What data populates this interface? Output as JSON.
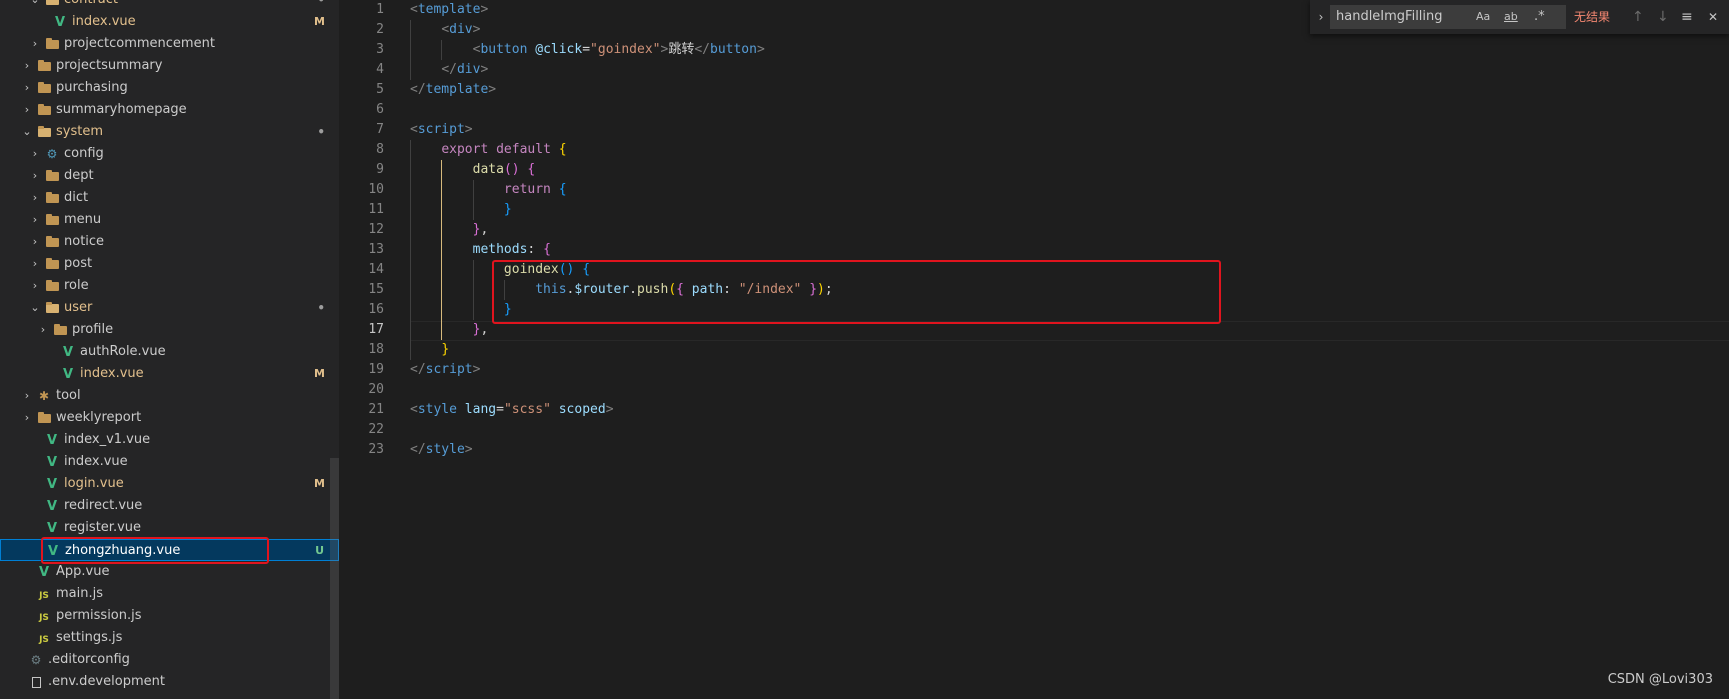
{
  "explorer": {
    "rows": [
      {
        "label": "contract",
        "type": "folder-open",
        "indent": 2,
        "expanded": true,
        "badge": "•",
        "badge_type": "dot",
        "status": "modified"
      },
      {
        "label": "index.vue",
        "type": "vue",
        "indent": 3,
        "badge": "M",
        "badge_type": "M",
        "status": "modified"
      },
      {
        "label": "projectcommencement",
        "type": "folder",
        "indent": 2,
        "expanded": false
      },
      {
        "label": "projectsummary",
        "type": "folder",
        "indent": 1,
        "expanded": false
      },
      {
        "label": "purchasing",
        "type": "folder",
        "indent": 1,
        "expanded": false
      },
      {
        "label": "summaryhomepage",
        "type": "folder",
        "indent": 1,
        "expanded": false
      },
      {
        "label": "system",
        "type": "folder-open",
        "indent": 1,
        "expanded": true,
        "badge": "•",
        "badge_type": "dot",
        "status": "modified"
      },
      {
        "label": "config",
        "type": "config",
        "indent": 2,
        "expanded": false
      },
      {
        "label": "dept",
        "type": "folder",
        "indent": 2,
        "expanded": false
      },
      {
        "label": "dict",
        "type": "folder",
        "indent": 2,
        "expanded": false
      },
      {
        "label": "menu",
        "type": "folder",
        "indent": 2,
        "expanded": false
      },
      {
        "label": "notice",
        "type": "folder",
        "indent": 2,
        "expanded": false
      },
      {
        "label": "post",
        "type": "folder",
        "indent": 2,
        "expanded": false
      },
      {
        "label": "role",
        "type": "folder",
        "indent": 2,
        "expanded": false
      },
      {
        "label": "user",
        "type": "folder-open",
        "indent": 2,
        "expanded": true,
        "badge": "•",
        "badge_type": "dot",
        "status": "modified"
      },
      {
        "label": "profile",
        "type": "folder",
        "indent": 3,
        "expanded": false
      },
      {
        "label": "authRole.vue",
        "type": "vue",
        "indent": 4
      },
      {
        "label": "index.vue",
        "type": "vue",
        "indent": 4,
        "badge": "M",
        "badge_type": "M",
        "status": "modified"
      },
      {
        "label": "tool",
        "type": "tool",
        "indent": 1,
        "expanded": false
      },
      {
        "label": "weeklyreport",
        "type": "folder",
        "indent": 1,
        "expanded": false
      },
      {
        "label": "index_v1.vue",
        "type": "vue",
        "indent": 2
      },
      {
        "label": "index.vue",
        "type": "vue",
        "indent": 2
      },
      {
        "label": "login.vue",
        "type": "vue",
        "indent": 2,
        "badge": "M",
        "badge_type": "M",
        "status": "modified"
      },
      {
        "label": "redirect.vue",
        "type": "vue",
        "indent": 2
      },
      {
        "label": "register.vue",
        "type": "vue",
        "indent": 2
      },
      {
        "label": "zhongzhuang.vue",
        "type": "vue",
        "indent": 2,
        "badge": "U",
        "badge_type": "U",
        "status": "untracked",
        "selected": true
      },
      {
        "label": "App.vue",
        "type": "vue",
        "indent": 1
      },
      {
        "label": "main.js",
        "type": "js",
        "indent": 1
      },
      {
        "label": "permission.js",
        "type": "js",
        "indent": 1
      },
      {
        "label": "settings.js",
        "type": "js",
        "indent": 1
      },
      {
        "label": ".editorconfig",
        "type": "gear",
        "indent": 0
      },
      {
        "label": ".env.development",
        "type": "file",
        "indent": 0
      }
    ]
  },
  "editor": {
    "active_line": 17,
    "lines": [
      [
        [
          "t-tag",
          "<"
        ],
        [
          "t-name",
          "template"
        ],
        [
          "t-tag",
          ">"
        ]
      ],
      [
        [
          "t-txt",
          "    "
        ],
        [
          "t-tag",
          "<"
        ],
        [
          "t-name",
          "div"
        ],
        [
          "t-tag",
          ">"
        ]
      ],
      [
        [
          "t-txt",
          "        "
        ],
        [
          "t-tag",
          "<"
        ],
        [
          "t-name",
          "button"
        ],
        [
          "t-txt",
          " "
        ],
        [
          "t-attr",
          "@click"
        ],
        [
          "t-txt",
          "="
        ],
        [
          "t-str",
          "\"goindex\""
        ],
        [
          "t-tag",
          ">"
        ],
        [
          "t-txt",
          "跳转"
        ],
        [
          "t-tag",
          "</"
        ],
        [
          "t-name",
          "button"
        ],
        [
          "t-tag",
          ">"
        ]
      ],
      [
        [
          "t-txt",
          "    "
        ],
        [
          "t-tag",
          "</"
        ],
        [
          "t-name",
          "div"
        ],
        [
          "t-tag",
          ">"
        ]
      ],
      [
        [
          "t-tag",
          "</"
        ],
        [
          "t-name",
          "template"
        ],
        [
          "t-tag",
          ">"
        ]
      ],
      [],
      [
        [
          "t-tag",
          "<"
        ],
        [
          "t-name",
          "script"
        ],
        [
          "t-tag",
          ">"
        ]
      ],
      [
        [
          "t-txt",
          "    "
        ],
        [
          "t-kw",
          "export"
        ],
        [
          "t-txt",
          " "
        ],
        [
          "t-kw",
          "default"
        ],
        [
          "t-txt",
          " "
        ],
        [
          "b1",
          "{"
        ]
      ],
      [
        [
          "t-txt",
          "        "
        ],
        [
          "t-fn",
          "data"
        ],
        [
          "b2",
          "()"
        ],
        [
          "t-txt",
          " "
        ],
        [
          "b2",
          "{"
        ]
      ],
      [
        [
          "t-txt",
          "            "
        ],
        [
          "t-kw",
          "return"
        ],
        [
          "t-txt",
          " "
        ],
        [
          "b3",
          "{"
        ]
      ],
      [
        [
          "t-txt",
          "            "
        ],
        [
          "b3",
          "}"
        ]
      ],
      [
        [
          "t-txt",
          "        "
        ],
        [
          "b2",
          "}"
        ],
        [
          "t-txt",
          ","
        ]
      ],
      [
        [
          "t-txt",
          "        "
        ],
        [
          "t-var",
          "methods"
        ],
        [
          "t-txt",
          ": "
        ],
        [
          "b2",
          "{"
        ]
      ],
      [
        [
          "t-txt",
          "            "
        ],
        [
          "t-fn",
          "goindex"
        ],
        [
          "b3",
          "()"
        ],
        [
          "t-txt",
          " "
        ],
        [
          "b3",
          "{"
        ]
      ],
      [
        [
          "t-txt",
          "                "
        ],
        [
          "t-this",
          "this"
        ],
        [
          "t-txt",
          "."
        ],
        [
          "t-var",
          "$router"
        ],
        [
          "t-txt",
          "."
        ],
        [
          "t-fn",
          "push"
        ],
        [
          "b1",
          "("
        ],
        [
          "b2",
          "{"
        ],
        [
          "t-txt",
          " "
        ],
        [
          "t-var",
          "path"
        ],
        [
          "t-txt",
          ": "
        ],
        [
          "t-str",
          "\"/index\""
        ],
        [
          "t-txt",
          " "
        ],
        [
          "b2",
          "}"
        ],
        [
          "b1",
          ")"
        ],
        [
          "t-txt",
          ";"
        ]
      ],
      [
        [
          "t-txt",
          "            "
        ],
        [
          "b3",
          "}"
        ]
      ],
      [
        [
          "t-txt",
          "        "
        ],
        [
          "b2",
          "}"
        ],
        [
          "t-txt",
          ","
        ]
      ],
      [
        [
          "t-txt",
          "    "
        ],
        [
          "b1",
          "}"
        ]
      ],
      [
        [
          "t-tag",
          "</"
        ],
        [
          "t-name",
          "script"
        ],
        [
          "t-tag",
          ">"
        ]
      ],
      [],
      [
        [
          "t-tag",
          "<"
        ],
        [
          "t-name",
          "style"
        ],
        [
          "t-txt",
          " "
        ],
        [
          "t-attr",
          "lang"
        ],
        [
          "t-txt",
          "="
        ],
        [
          "t-str",
          "\"scss\""
        ],
        [
          "t-txt",
          " "
        ],
        [
          "t-attr",
          "scoped"
        ],
        [
          "t-tag",
          ">"
        ]
      ],
      [],
      [
        [
          "t-tag",
          "</"
        ],
        [
          "t-name",
          "style"
        ],
        [
          "t-tag",
          ">"
        ]
      ]
    ]
  },
  "find_widget": {
    "query": "handleImgFilling",
    "match_case_label": "Aa",
    "whole_word_label": "ab",
    "regex_label": ".*",
    "result_text": "无结果",
    "prev_label": "↑",
    "next_label": "↓",
    "selection_label": "≡",
    "close_label": "✕"
  },
  "watermark": "CSDN @Lovi303",
  "colors": {
    "highlight_box": "#e0141e",
    "selected_row": "#04395e",
    "untracked": "#73c991",
    "modified": "#e2c08d"
  }
}
